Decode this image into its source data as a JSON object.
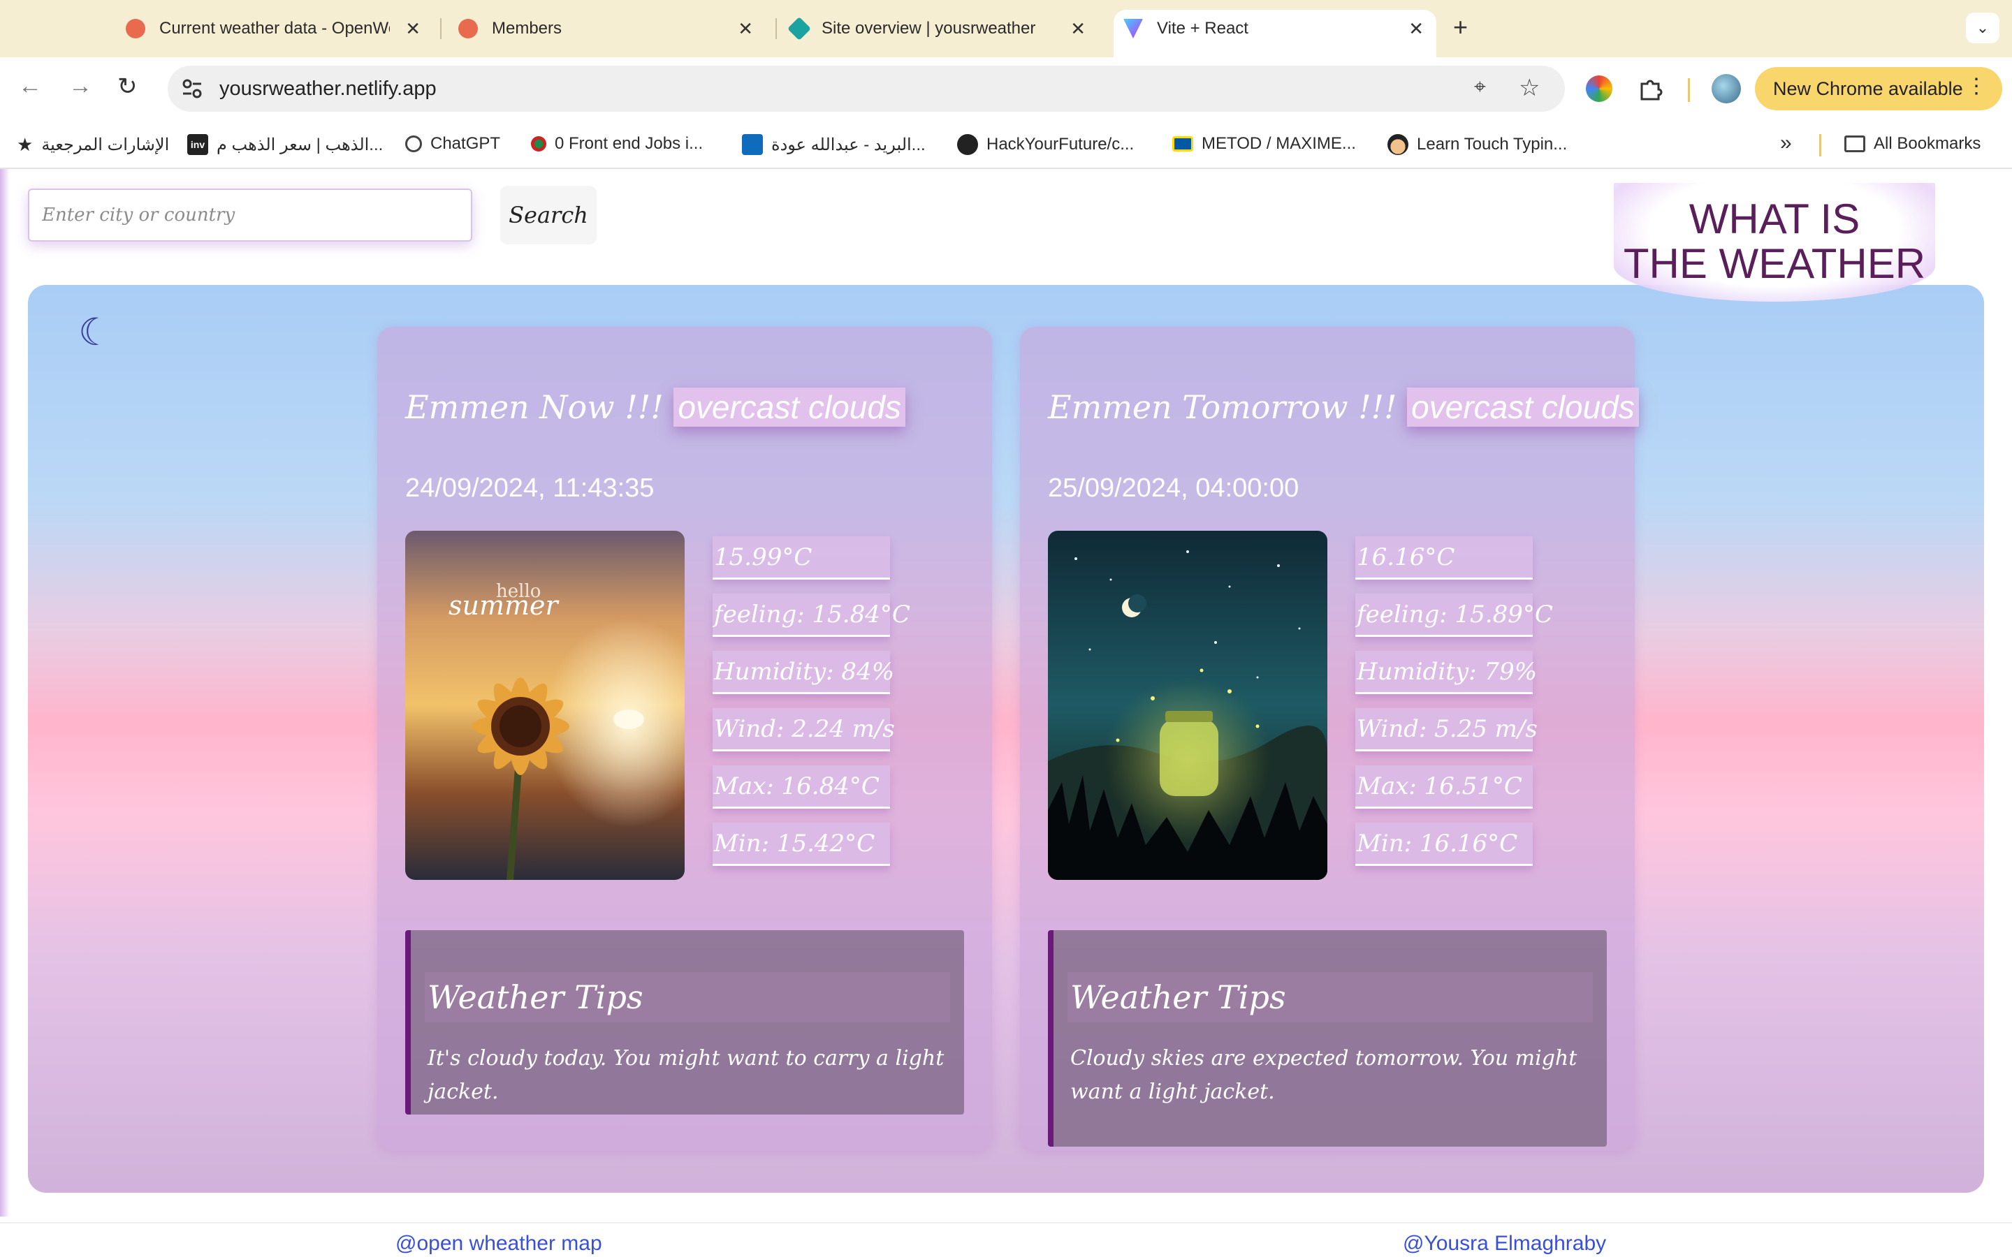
{
  "browser": {
    "tabs": [
      {
        "title": "Current weather data - OpenWeatherMap",
        "favicon_color": "#e96b4d"
      },
      {
        "title": "Members",
        "favicon_color": "#e96b4d"
      },
      {
        "title": "Site overview | yousrweather",
        "favicon_color": "#1aa3a0"
      },
      {
        "title": "Vite + React",
        "favicon_color": "#8f5cf6",
        "active": true
      }
    ],
    "new_tab_icon": "plus-icon",
    "url": "yousrweather.netlify.app",
    "update_label": "New Chrome available",
    "bookmarks": [
      {
        "label": "الإشارات المرجعية",
        "icon": "star-icon"
      },
      {
        "label": "الذهب | سعر الذهب م...",
        "icon": "inv-icon"
      },
      {
        "label": "ChatGPT",
        "icon": "chatgpt-icon"
      },
      {
        "label": "0 Front end Jobs i...",
        "icon": "leaf-icon"
      },
      {
        "label": "البريد - عبدالله عودة...",
        "icon": "outlook-icon"
      },
      {
        "label": "HackYourFuture/c...",
        "icon": "github-icon"
      },
      {
        "label": "METOD / MAXIME...",
        "icon": "ikea-icon"
      },
      {
        "label": "Learn Touch Typin...",
        "icon": "typing-icon"
      }
    ],
    "all_bookmarks": "All Bookmarks"
  },
  "page": {
    "search": {
      "placeholder": "Enter city or country",
      "button": "Search"
    },
    "brand": {
      "line1": "WHAT IS",
      "line2": "THE WEATHER"
    },
    "theme_icon": "moon-icon",
    "cards": [
      {
        "title": "Emmen Now !!!",
        "condition": "overcast clouds",
        "datetime": "24/09/2024, 11:43:35",
        "image": "sunflower-summer",
        "image_text": "hello summer",
        "temp": "15.99°C",
        "feeling": "feeling: 15.84°C",
        "humidity": "Humidity: 84%",
        "wind": "Wind: 2.24 m/s",
        "max": "Max: 16.84°C",
        "min": "Min: 15.42°C",
        "tips_title": "Weather Tips",
        "tips_text": "It's cloudy today. You might want to carry a light jacket."
      },
      {
        "title": "Emmen Tomorrow !!!",
        "condition": "overcast clouds",
        "datetime": "25/09/2024, 04:00:00",
        "image": "night-fireflies-jar",
        "temp": "16.16°C",
        "feeling": "feeling: 15.89°C",
        "humidity": "Humidity: 79%",
        "wind": "Wind: 5.25 m/s",
        "max": "Max: 16.51°C",
        "min": "Min: 16.16°C",
        "tips_title": "Weather Tips",
        "tips_text": "Cloudy skies are expected tomorrow. You might want a light jacket."
      }
    ],
    "footer": {
      "left": "@open wheather map",
      "right": "@Yousra Elmaghraby"
    }
  }
}
